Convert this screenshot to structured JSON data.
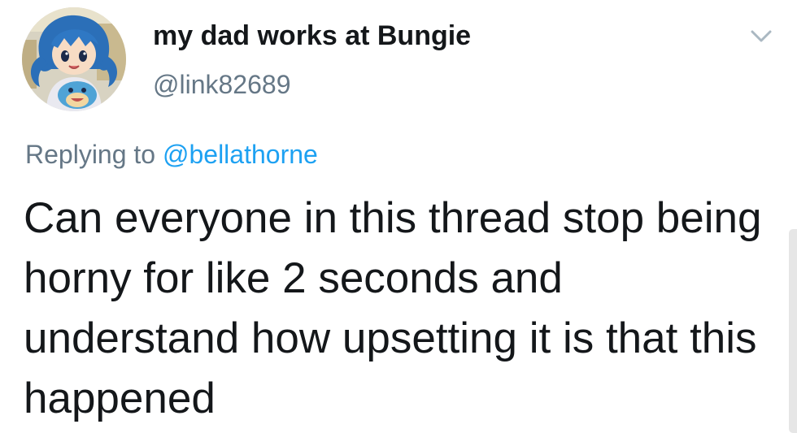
{
  "tweet": {
    "display_name": "my dad works at Bungie",
    "handle": "@link82689",
    "replying_prefix": "Replying to",
    "replying_to": "@bellathorne",
    "text": "Can everyone in this thread stop being horny for like 2 seconds and understand how upsetting it is that this happened"
  },
  "icons": {
    "more": "chevron-down-icon",
    "avatar": "avatar-image"
  },
  "colors": {
    "primary_text": "#14171a",
    "secondary_text": "#657786",
    "link": "#1da1f2"
  }
}
